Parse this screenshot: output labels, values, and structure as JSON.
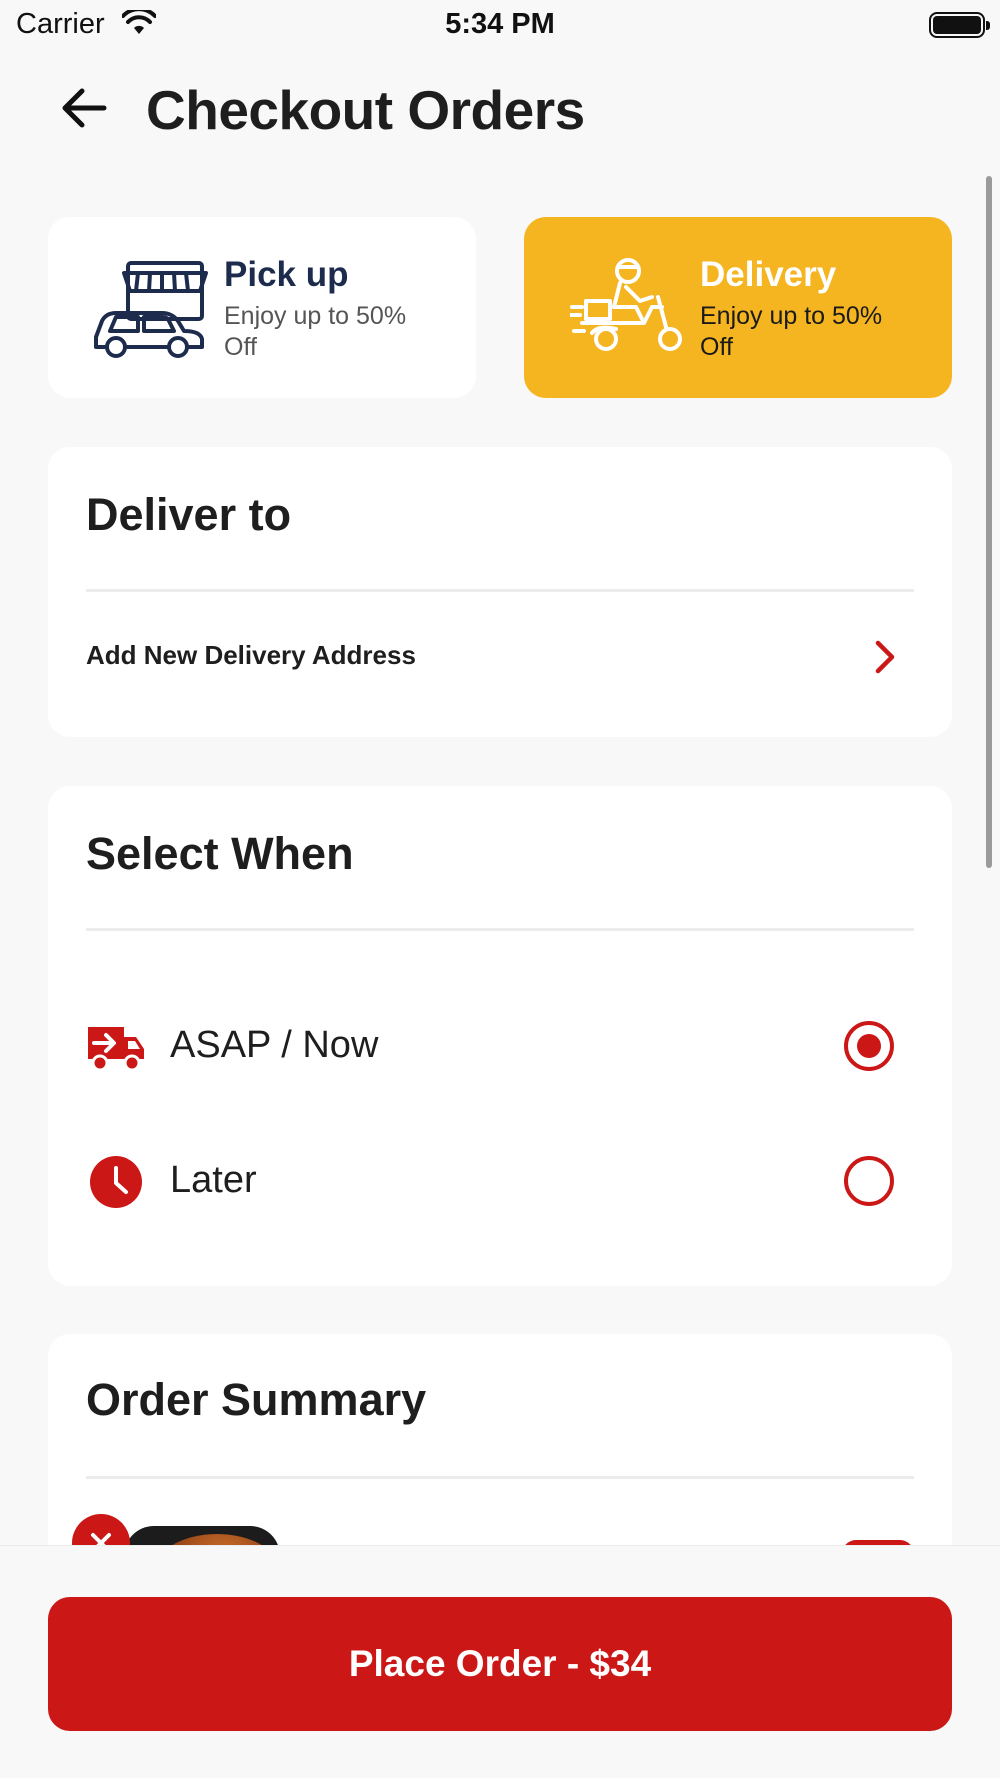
{
  "status_bar": {
    "carrier": "Carrier",
    "time": "5:34 PM"
  },
  "header": {
    "title": "Checkout Orders"
  },
  "modes": {
    "pickup": {
      "title": "Pick up",
      "subtitle": "Enjoy up to 50% Off",
      "icon": "store-car-icon",
      "selected": false
    },
    "delivery": {
      "title": "Delivery",
      "subtitle": "Enjoy up to 50% Off",
      "icon": "scooter-rider-icon",
      "selected": true
    }
  },
  "deliver_to": {
    "title": "Deliver to",
    "add_address_label": "Add New Delivery Address"
  },
  "select_when": {
    "title": "Select When",
    "options": [
      {
        "label": "ASAP / Now",
        "icon": "delivery-truck-icon",
        "selected": true
      },
      {
        "label": "Later",
        "icon": "clock-icon",
        "selected": false
      }
    ]
  },
  "order_summary": {
    "title": "Order Summary"
  },
  "footer": {
    "place_order_label": "Place Order - $34"
  },
  "colors": {
    "primary_red": "#cc1717",
    "delivery_yellow": "#f5b521",
    "navy": "#1d2c4d"
  }
}
